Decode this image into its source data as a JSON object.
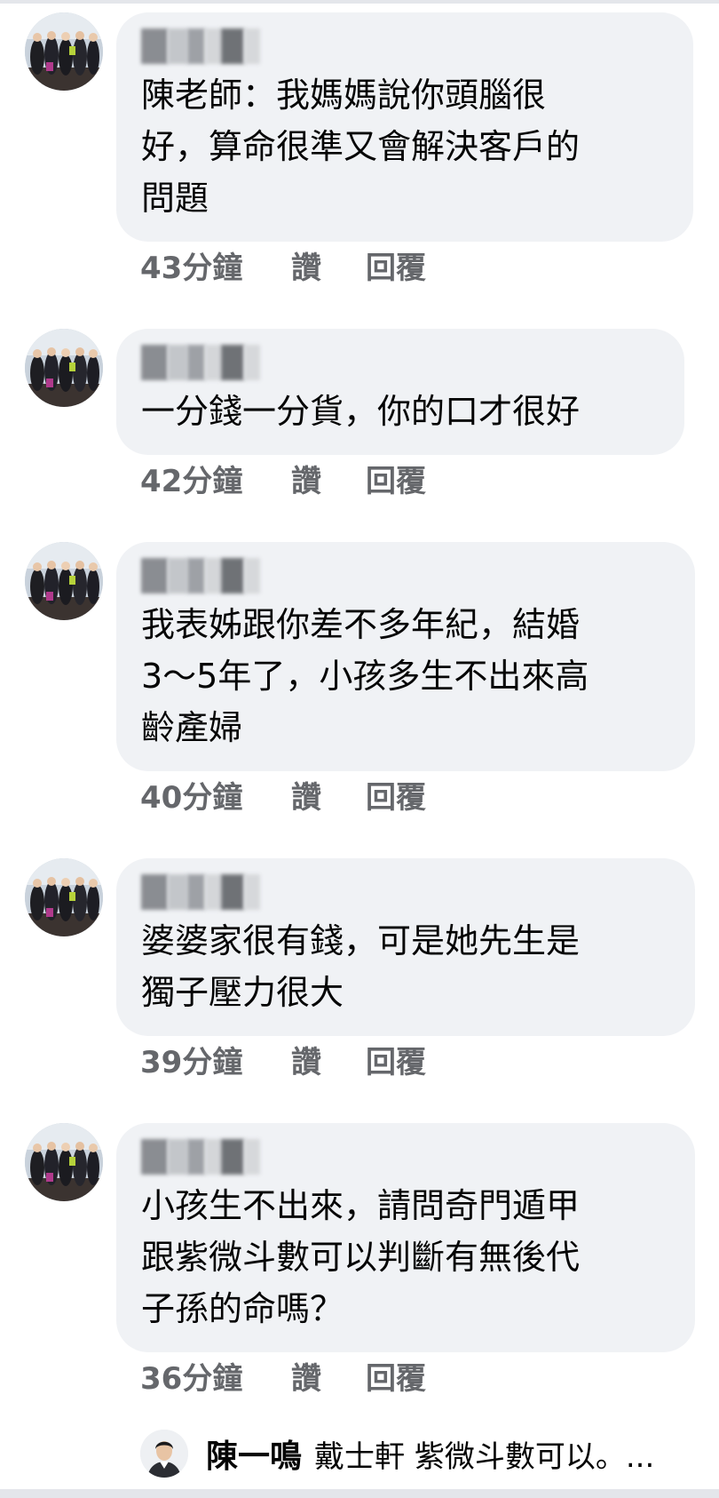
{
  "comments": [
    {
      "text": "陳老師：我媽媽說你頭腦很\n好，算命很準又會解決客戶的\n問題",
      "time": "43分鐘",
      "like": "讚",
      "reply": "回覆"
    },
    {
      "text": "一分錢一分貨，你的口才很好",
      "time": "42分鐘",
      "like": "讚",
      "reply": "回覆"
    },
    {
      "text": "我表姊跟你差不多年紀，結婚\n3～5年了，小孩多生不出來高\n齡產婦",
      "time": "40分鐘",
      "like": "讚",
      "reply": "回覆"
    },
    {
      "text": "婆婆家很有錢，可是她先生是\n獨子壓力很大",
      "time": "39分鐘",
      "like": "讚",
      "reply": "回覆"
    },
    {
      "text": "小孩生不出來，請問奇門遁甲\n跟紫微斗數可以判斷有無後代\n子孫的命嗎？",
      "time": "36分鐘",
      "like": "讚",
      "reply": "回覆"
    }
  ],
  "reply_preview": {
    "author": "陳一鳴",
    "text": "戴士軒 紫微斗數可以。..."
  }
}
